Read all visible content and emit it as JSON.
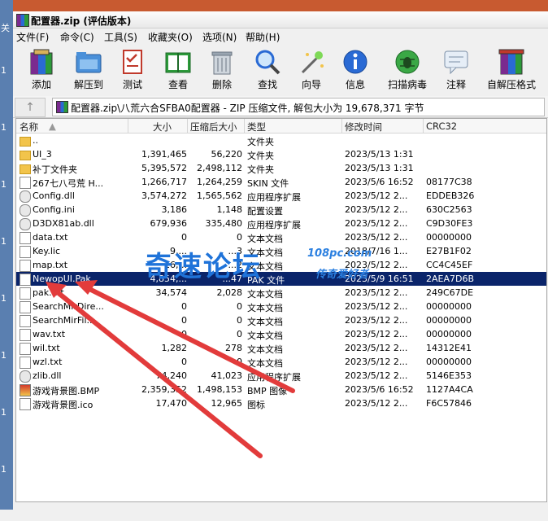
{
  "window": {
    "title": "配置器.zip (评估版本)"
  },
  "desktop": {
    "left_labels": [
      "关",
      "1",
      "1",
      "1",
      "1",
      "1",
      "1",
      "1",
      "1"
    ]
  },
  "menu": [
    "文件(F)",
    "命令(C)",
    "工具(S)",
    "收藏夹(O)",
    "选项(N)",
    "帮助(H)"
  ],
  "toolbar": [
    {
      "label": "添加",
      "icon": "add-archive-icon"
    },
    {
      "label": "解压到",
      "icon": "extract-folder-icon"
    },
    {
      "label": "测试",
      "icon": "test-checklist-icon"
    },
    {
      "label": "查看",
      "icon": "view-book-icon"
    },
    {
      "label": "删除",
      "icon": "trash-icon"
    },
    {
      "label": "查找",
      "icon": "magnifier-icon"
    },
    {
      "label": "向导",
      "icon": "wizard-wand-icon"
    },
    {
      "label": "信息",
      "icon": "info-icon"
    },
    {
      "label": "扫描病毒",
      "icon": "bug-scan-icon"
    },
    {
      "label": "注释",
      "icon": "comment-icon"
    },
    {
      "label": "自解压格式",
      "icon": "sfx-archive-icon"
    }
  ],
  "address": {
    "up_label": "↑",
    "path": "配置器.zip\\八荒六合SFBA0配置器 - ZIP 压缩文件, 解包大小为 19,678,371 字节"
  },
  "columns": [
    "名称",
    "大小",
    "压缩后大小",
    "类型",
    "修改时间",
    "CRC32"
  ],
  "rows": [
    {
      "name": "..",
      "size": "",
      "packed": "",
      "type": "文件夹",
      "mtime": "",
      "crc": "",
      "icon": "folder"
    },
    {
      "name": "UI_3",
      "size": "1,391,465",
      "packed": "56,220",
      "type": "文件夹",
      "mtime": "2023/5/13 1:31",
      "crc": "",
      "icon": "folder"
    },
    {
      "name": "补丁文件夹",
      "size": "5,395,572",
      "packed": "2,498,112",
      "type": "文件夹",
      "mtime": "2023/5/13 1:31",
      "crc": "",
      "icon": "folder"
    },
    {
      "name": "267七八弓荒 H...",
      "size": "1,266,717",
      "packed": "1,264,259",
      "type": "SKIN 文件",
      "mtime": "2023/5/6 16:52",
      "crc": "08177C38",
      "icon": "file"
    },
    {
      "name": "Config.dll",
      "size": "3,574,272",
      "packed": "1,565,562",
      "type": "应用程序扩展",
      "mtime": "2023/5/12 2...",
      "crc": "EDDEB326",
      "icon": "gear"
    },
    {
      "name": "Config.ini",
      "size": "3,186",
      "packed": "1,148",
      "type": "配置设置",
      "mtime": "2023/5/12 2...",
      "crc": "630C2563",
      "icon": "gear"
    },
    {
      "name": "D3DX81ab.dll",
      "size": "679,936",
      "packed": "335,480",
      "type": "应用程序扩展",
      "mtime": "2023/5/12 2...",
      "crc": "C9D30FE3",
      "icon": "gear"
    },
    {
      "name": "data.txt",
      "size": "0",
      "packed": "0",
      "type": "文本文档",
      "mtime": "2023/5/12 2...",
      "crc": "00000000",
      "icon": "file"
    },
    {
      "name": "Key.lic",
      "size": "9,...",
      "packed": "...3",
      "type": "文本文档",
      "mtime": "2018/7/16 1...",
      "crc": "E27B1F02",
      "icon": "file"
    },
    {
      "name": "map.txt",
      "size": "16,...",
      "packed": "...2",
      "type": "文本文档",
      "mtime": "2023/5/12 2...",
      "crc": "CC4C45EF",
      "icon": "file"
    },
    {
      "name": "NewopUI.Pak",
      "size": "4,854,...",
      "packed": "...47",
      "type": "PAK 文件",
      "mtime": "2023/5/9 16:51",
      "crc": "2AEA7D6B",
      "icon": "pak",
      "selected": true
    },
    {
      "name": "pak.txt",
      "size": "34,574",
      "packed": "2,028",
      "type": "文本文档",
      "mtime": "2023/5/12 2...",
      "crc": "249C67DE",
      "icon": "file"
    },
    {
      "name": "SearchMirDire...",
      "size": "0",
      "packed": "0",
      "type": "文本文档",
      "mtime": "2023/5/12 2...",
      "crc": "00000000",
      "icon": "file"
    },
    {
      "name": "SearchMirFil...",
      "size": "0",
      "packed": "0",
      "type": "文本文档",
      "mtime": "2023/5/12 2...",
      "crc": "00000000",
      "icon": "file"
    },
    {
      "name": "wav.txt",
      "size": "0",
      "packed": "0",
      "type": "文本文档",
      "mtime": "2023/5/12 2...",
      "crc": "00000000",
      "icon": "file"
    },
    {
      "name": "wil.txt",
      "size": "1,282",
      "packed": "278",
      "type": "文本文档",
      "mtime": "2023/5/12 2...",
      "crc": "14312E41",
      "icon": "file"
    },
    {
      "name": "wzl.txt",
      "size": "0",
      "packed": "0",
      "type": "文本文档",
      "mtime": "2023/5/12 2...",
      "crc": "00000000",
      "icon": "file"
    },
    {
      "name": "zlib.dll",
      "size": "74,240",
      "packed": "41,023",
      "type": "应用程序扩展",
      "mtime": "2023/5/12 2...",
      "crc": "5146E353",
      "icon": "gear"
    },
    {
      "name": "游戏背景图.BMP",
      "size": "2,359,352",
      "packed": "1,498,153",
      "type": "BMP 图像",
      "mtime": "2023/5/6 16:52",
      "crc": "1127A4CA",
      "icon": "bmp"
    },
    {
      "name": "游戏背景图.ico",
      "size": "17,470",
      "packed": "12,965",
      "type": "图标",
      "mtime": "2023/5/12 2...",
      "crc": "F6C57846",
      "icon": "file"
    }
  ],
  "watermark": {
    "main": "奇速论坛",
    "domain": "108pc.com",
    "tagline": "传奇爱好者"
  },
  "colors": {
    "selection": "#0a246a",
    "arrow": "#e23b3b",
    "watermark": "#1f73d9"
  }
}
